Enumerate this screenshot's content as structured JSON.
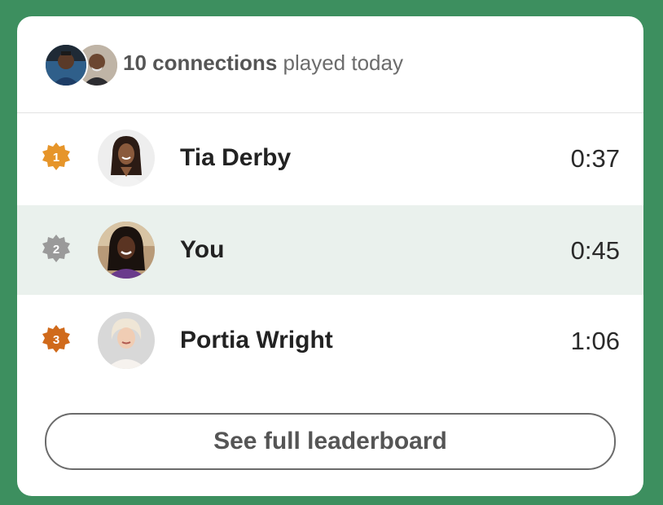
{
  "header": {
    "count_label": "10 connections",
    "suffix_label": "played today"
  },
  "leaderboard": [
    {
      "rank": "1",
      "name": "Tia Derby",
      "time": "0:37",
      "badge_color": "#e6952a",
      "highlight": false
    },
    {
      "rank": "2",
      "name": "You",
      "time": "0:45",
      "badge_color": "#9a9a9a",
      "highlight": true
    },
    {
      "rank": "3",
      "name": "Portia Wright",
      "time": "1:06",
      "badge_color": "#d06a1b",
      "highlight": false
    }
  ],
  "footer": {
    "button_label": "See full leaderboard"
  },
  "colors": {
    "background": "#3d8f5f",
    "highlight_row": "#eaf1ed"
  }
}
